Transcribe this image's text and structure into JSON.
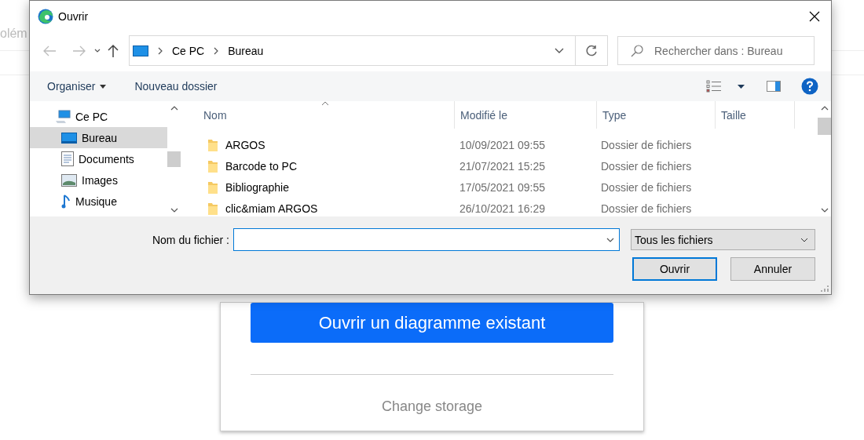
{
  "background_page": {
    "heading_fragment": "olém",
    "card": {
      "primary_button": "Ouvrir un diagramme existant",
      "link": "Change storage"
    }
  },
  "dialog": {
    "title": "Ouvrir",
    "address_bar": {
      "breadcrumbs": [
        "Ce PC",
        "Bureau"
      ]
    },
    "search": {
      "placeholder": "Rechercher dans : Bureau"
    },
    "toolbar": {
      "organize": "Organiser",
      "new_folder": "Nouveau dossier"
    },
    "nav_pane": {
      "items": [
        {
          "label": "Ce PC",
          "kind": "computer",
          "selected": false,
          "children": [
            {
              "label": "Bureau",
              "kind": "desktop",
              "selected": true
            },
            {
              "label": "Documents",
              "kind": "documents",
              "selected": false
            },
            {
              "label": "Images",
              "kind": "images",
              "selected": false
            },
            {
              "label": "Musique",
              "kind": "music",
              "selected": false
            }
          ]
        }
      ]
    },
    "file_list": {
      "columns": [
        {
          "label": "Nom",
          "sorted": true
        },
        {
          "label": "Modifié le",
          "sorted": false
        },
        {
          "label": "Type",
          "sorted": false
        },
        {
          "label": "Taille",
          "sorted": false
        }
      ],
      "rows": [
        {
          "name": "ARGOS",
          "modified": "10/09/2021 09:55",
          "type": "Dossier de fichiers"
        },
        {
          "name": "Barcode to PC",
          "modified": "21/07/2021 15:25",
          "type": "Dossier de fichiers"
        },
        {
          "name": "Bibliographie",
          "modified": "17/05/2021 09:55",
          "type": "Dossier de fichiers"
        },
        {
          "name": "clic&miam ARGOS",
          "modified": "26/10/2021 16:29",
          "type": "Dossier de fichiers"
        }
      ]
    },
    "file_name": {
      "label": "Nom du fichier :"
    },
    "file_type": {
      "value": "Tous les fichiers"
    },
    "buttons": [
      {
        "label": "Ouvrir",
        "default": true
      },
      {
        "label": "Annuler",
        "default": false
      }
    ]
  }
}
